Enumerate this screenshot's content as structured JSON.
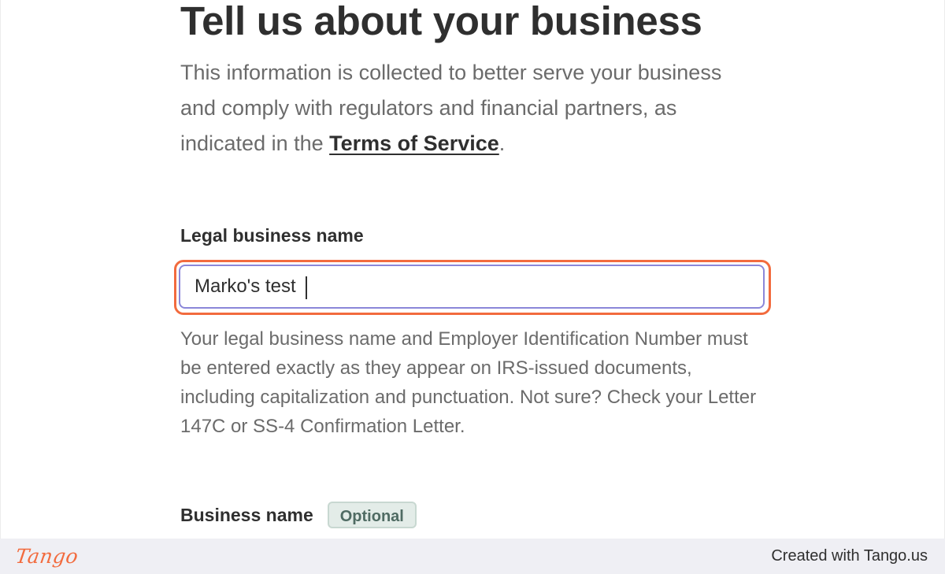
{
  "page": {
    "title": "Tell us about your business",
    "intro_before_link": "This information is collected to better serve your business and comply with regulators and financial partners, as indicated in the ",
    "intro_link": "Terms of Service",
    "intro_after_link": "."
  },
  "legal_business_name": {
    "label": "Legal business name",
    "value": "Marko's test",
    "help_text": "Your legal business name and Employer Identification Number must be entered exactly as they appear on IRS-issued documents, including capitalization and punctuation. Not sure? Check your Letter 147C or SS-4 Confirmation Letter."
  },
  "business_name": {
    "label": "Business name",
    "badge": "Optional"
  },
  "footer": {
    "logo_text": "Tango",
    "credit": "Created with Tango.us"
  },
  "colors": {
    "highlight": "#f26b3e",
    "input_border": "#8b87d9",
    "text_dark": "#2f2f2f",
    "text_muted": "#6b6b6b",
    "badge_bg": "#e3ece8",
    "footer_bg": "#efeff4"
  }
}
